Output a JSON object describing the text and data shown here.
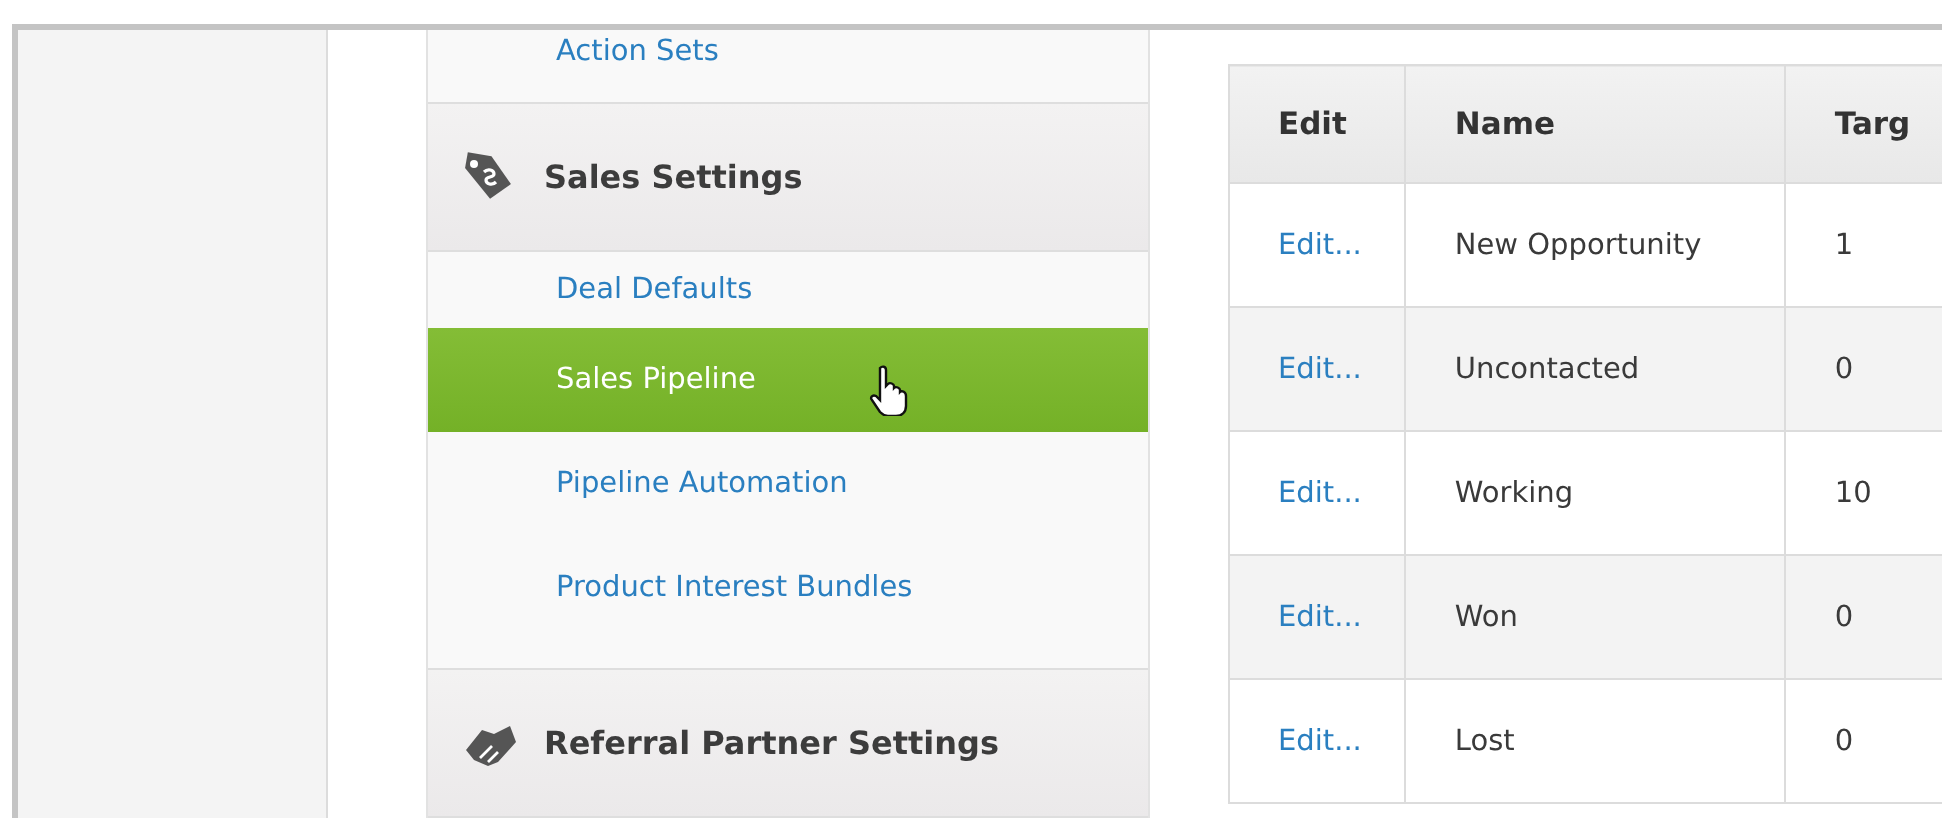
{
  "sidebar": {
    "sections": [
      {
        "kind": "tail",
        "items": [
          {
            "label": "Action Sets",
            "selected": false
          }
        ]
      },
      {
        "kind": "section",
        "title": "Sales Settings",
        "items": [
          {
            "label": "Deal Defaults",
            "selected": false
          },
          {
            "label": "Sales Pipeline",
            "selected": true
          },
          {
            "label": "Pipeline Automation",
            "selected": false
          },
          {
            "label": "Product Interest Bundles",
            "selected": false
          }
        ]
      },
      {
        "kind": "section",
        "title": "Referral Partner Settings"
      }
    ]
  },
  "table": {
    "columns": [
      "Edit",
      "Name",
      "Targ"
    ],
    "rows": [
      {
        "edit": "Edit...",
        "name": "New Opportunity",
        "target": "1"
      },
      {
        "edit": "Edit...",
        "name": "Uncontacted",
        "target": "0"
      },
      {
        "edit": "Edit...",
        "name": "Working",
        "target": "10"
      },
      {
        "edit": "Edit...",
        "name": "Won",
        "target": "0"
      },
      {
        "edit": "Edit...",
        "name": "Lost",
        "target": "0"
      }
    ]
  }
}
